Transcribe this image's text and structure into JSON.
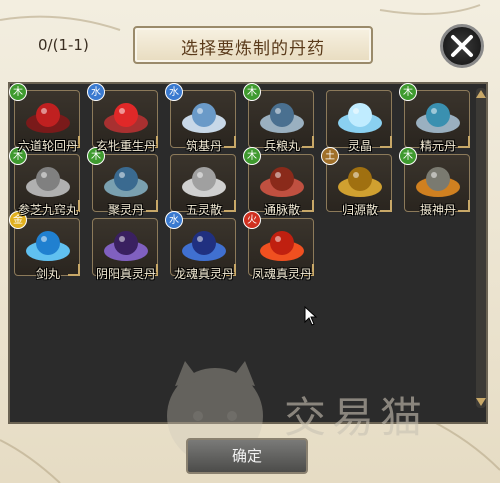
{
  "header": {
    "count": "0/(1-1)",
    "title": "选择要炼制的丹药"
  },
  "items": [
    {
      "name": "六道轮回丹",
      "element": "木",
      "type": "wood"
    },
    {
      "name": "玄牝重生丹",
      "element": "水",
      "type": "water"
    },
    {
      "name": "筑基丹",
      "element": "水",
      "type": "water"
    },
    {
      "name": "兵粮丸",
      "element": "木",
      "type": "wood"
    },
    {
      "name": "灵晶",
      "element": "",
      "type": ""
    },
    {
      "name": "精元丹",
      "element": "木",
      "type": "wood"
    },
    {
      "name": "参芝九窍丸",
      "element": "木",
      "type": "wood"
    },
    {
      "name": "聚灵丹",
      "element": "木",
      "type": "wood"
    },
    {
      "name": "五灵散",
      "element": "",
      "type": ""
    },
    {
      "name": "通脉散",
      "element": "木",
      "type": "wood"
    },
    {
      "name": "归源散",
      "element": "土",
      "type": "earth"
    },
    {
      "name": "摄神丹",
      "element": "木",
      "type": "wood"
    },
    {
      "name": "剑丸",
      "element": "金",
      "type": "metal"
    },
    {
      "name": "阴阳真灵丹",
      "element": "",
      "type": ""
    },
    {
      "name": "龙魂真灵丹",
      "element": "水",
      "type": "water"
    },
    {
      "name": "凤魂真灵丹",
      "element": "火",
      "type": "fire"
    }
  ],
  "footer": {
    "confirm_label": "确定"
  },
  "watermark": {
    "text": "交易猫"
  },
  "colors": {
    "wood": "#3f9a2f",
    "water": "#3a7ad0",
    "earth": "#a0702a",
    "metal": "#e0b020",
    "fire": "#d03020"
  }
}
